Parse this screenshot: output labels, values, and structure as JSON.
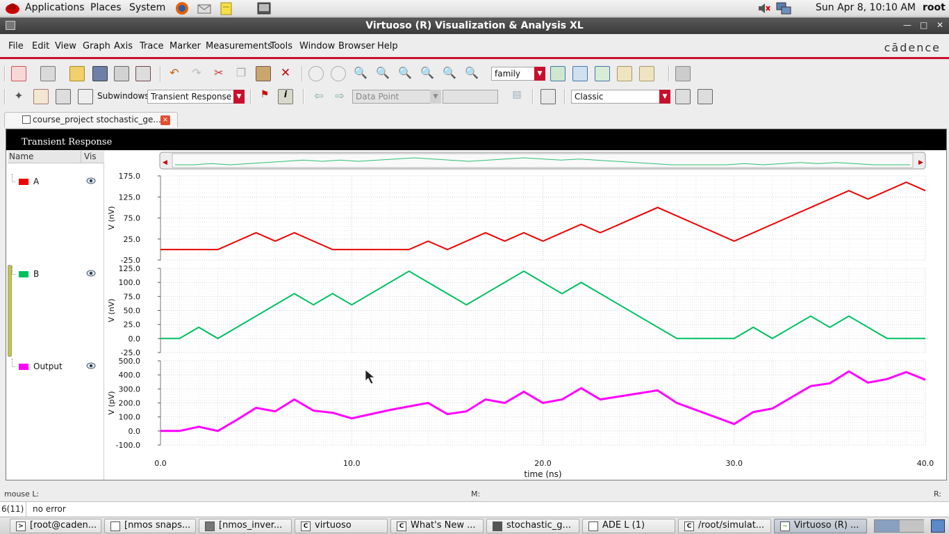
{
  "top_panel": {
    "menus": [
      "Applications",
      "Places",
      "System"
    ],
    "datetime": "Sun Apr  8, 10:10 AM",
    "user": "root"
  },
  "window": {
    "title": "Virtuoso (R) Visualization & Analysis XL",
    "brand": "cādence"
  },
  "menu_bar": [
    "File",
    "Edit",
    "View",
    "Graph",
    "Axis",
    "Trace",
    "Marker",
    "Measurements",
    "Tools",
    "Window",
    "Browser",
    "Help"
  ],
  "toolbar1": {
    "family_value": "family"
  },
  "toolbar2": {
    "subwindows_label": "Subwindows:",
    "subwindow_value": "Transient Response",
    "data_point_value": "Data Point",
    "style_value": "Classic"
  },
  "tab": {
    "label": "course_project stochastic_ge...",
    "close": "×"
  },
  "subwindow": {
    "title": "Transient Response"
  },
  "signals": {
    "header": {
      "name": "Name",
      "vis": "Vis"
    },
    "items": [
      {
        "name": "A",
        "color": "#ee0000"
      },
      {
        "name": "B",
        "color": "#00c060"
      },
      {
        "name": "Output",
        "color": "#ff00ff"
      }
    ]
  },
  "chart_data": {
    "type": "line",
    "xlabel": "time (ns)",
    "xlim": [
      0.0,
      40.0
    ],
    "xticks": [
      "0.0",
      "10.0",
      "20.0",
      "30.0",
      "40.0"
    ],
    "grid": true,
    "strips": [
      {
        "name": "A",
        "color": "#ee0000",
        "ylabel": "V (nV)",
        "ylim": [
          -25.0,
          175.0
        ],
        "yticks": [
          "175.0",
          "125.0",
          "75.0",
          "25.0",
          "-25.0"
        ],
        "x": [
          0,
          3,
          5,
          6,
          7,
          9,
          10,
          13,
          14,
          15,
          17,
          18,
          19,
          20,
          22,
          23,
          26,
          30,
          36,
          37,
          39,
          40
        ],
        "y": [
          0,
          0,
          40,
          20,
          40,
          0,
          0,
          0,
          20,
          0,
          40,
          20,
          40,
          20,
          60,
          40,
          100,
          20,
          140,
          120,
          160,
          140
        ]
      },
      {
        "name": "B",
        "color": "#00c060",
        "ylabel": "V (nV)",
        "ylim": [
          -25.0,
          125.0
        ],
        "yticks": [
          "125.0",
          "100.0",
          "75.0",
          "50.0",
          "25.0",
          "0.0",
          "-25.0"
        ],
        "x": [
          0,
          1,
          2,
          3,
          7,
          8,
          9,
          10,
          13,
          16,
          19,
          21,
          22,
          27,
          30,
          31,
          32,
          34,
          35,
          36,
          38,
          40
        ],
        "y": [
          0,
          0,
          20,
          0,
          80,
          60,
          80,
          60,
          120,
          60,
          120,
          80,
          100,
          0,
          0,
          20,
          0,
          40,
          20,
          40,
          0,
          0
        ]
      },
      {
        "name": "Output",
        "color": "#ff00ff",
        "ylabel": "V (pV)",
        "ylim": [
          -100.0,
          500.0
        ],
        "yticks": [
          "500.0",
          "400.0",
          "300.0",
          "200.0",
          "100.0",
          "0.0",
          "-100.0"
        ],
        "x": [
          0,
          1,
          2,
          3,
          4,
          5,
          6,
          7,
          8,
          9,
          10,
          11,
          12,
          13,
          14,
          15,
          16,
          17,
          18,
          19,
          20,
          21,
          22,
          23,
          26,
          27,
          30,
          31,
          32,
          33,
          34,
          35,
          36,
          37,
          38,
          39,
          40
        ],
        "y": [
          0,
          0,
          30,
          0,
          80,
          165,
          140,
          225,
          145,
          130,
          90,
          120,
          150,
          175,
          200,
          120,
          140,
          225,
          200,
          280,
          200,
          225,
          305,
          225,
          290,
          200,
          50,
          135,
          160,
          240,
          320,
          340,
          425,
          345,
          370,
          420,
          365
        ]
      }
    ]
  },
  "status": {
    "mouse": "mouse L:",
    "m": "M:",
    "r": "R:",
    "count": "6(11)",
    "message": "no error"
  },
  "taskbar": [
    {
      "label": "[root@caden...",
      "icon": "terminal-icon"
    },
    {
      "label": "[nmos snaps...",
      "icon": "window-icon"
    },
    {
      "label": "[nmos_inver...",
      "icon": "window-icon"
    },
    {
      "label": "virtuoso",
      "icon": "cadence-icon"
    },
    {
      "label": "What's New ...",
      "icon": "cadence-icon"
    },
    {
      "label": "stochastic_g...",
      "icon": "schematic-icon"
    },
    {
      "label": "ADE L (1)",
      "icon": "ade-icon"
    },
    {
      "label": "/root/simulat...",
      "icon": "cadence-icon"
    },
    {
      "label": "Virtuoso (R) ...",
      "icon": "waveform-icon"
    }
  ]
}
